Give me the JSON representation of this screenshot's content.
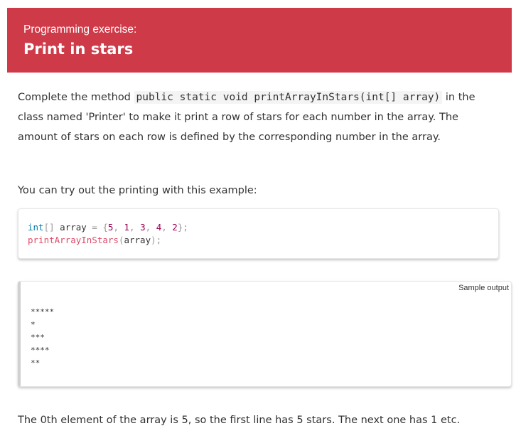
{
  "exercise": {
    "kicker": "Programming exercise:",
    "title": "Print in stars"
  },
  "description": {
    "before": "Complete the method ",
    "method_signature": "public static void printArrayInStars(int[] array)",
    "after": " in the class named 'Printer' to make it print a row of stars for each number in the array. The amount of stars on each row is defined by the corresponding number in the array."
  },
  "try_text": "You can try out the printing with this example:",
  "code": {
    "line1": {
      "type": "int",
      "brackets": "[]",
      "var": " array ",
      "eq": "=",
      "open": " {",
      "nums": [
        "5",
        "1",
        "3",
        "4",
        "2"
      ],
      "close": "};"
    },
    "line2": {
      "fn": "printArrayInStars",
      "open": "(",
      "arg": "array",
      "close": ");"
    }
  },
  "sample_output": {
    "label": "Sample output",
    "lines": [
      "*****",
      "*",
      "***",
      "****",
      "**"
    ]
  },
  "explanation": "The 0th element of the array is 5, so the first line has 5 stars. The next one has 1 etc.",
  "colors": {
    "banner": "#cf3a48",
    "keyword": "#0077aa",
    "number": "#990055",
    "function": "#dd4a68"
  }
}
